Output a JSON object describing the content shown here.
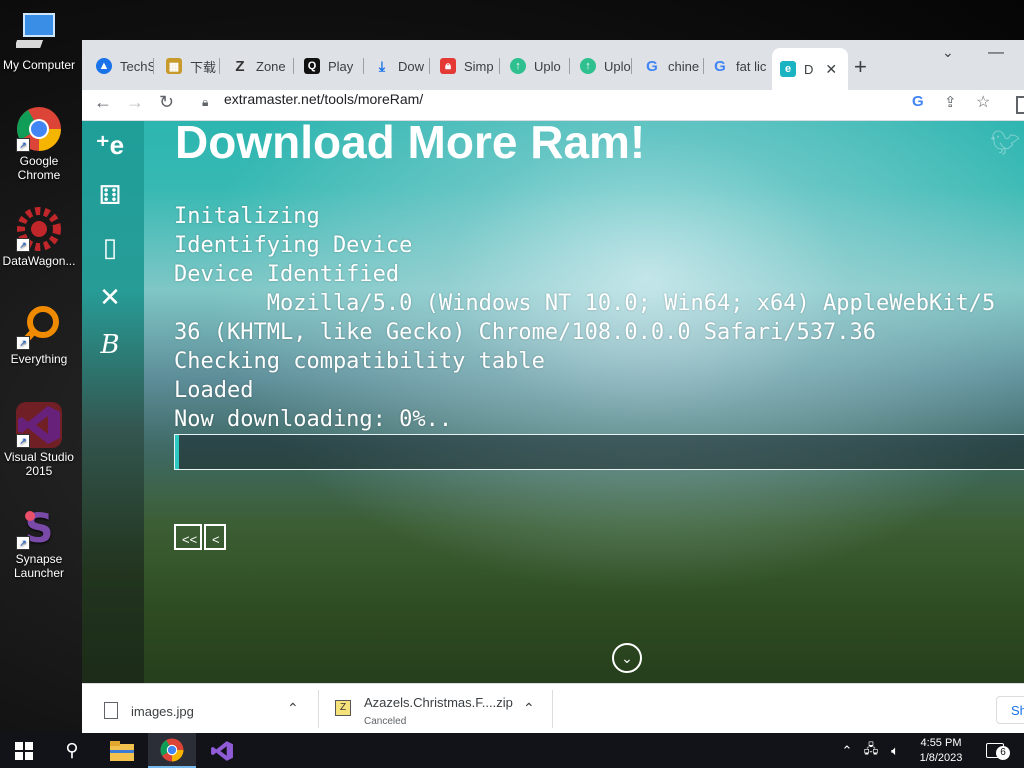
{
  "desktop": {
    "icons": [
      {
        "label": "My Computer"
      },
      {
        "label": "Google Chrome"
      },
      {
        "label": "DataWagon..."
      },
      {
        "label": "Everything"
      },
      {
        "label": "Visual Studio 2015"
      },
      {
        "label": "Synapse Launcher"
      }
    ]
  },
  "browser": {
    "tabs": [
      {
        "label": "TechS",
        "icon": "tech-icon",
        "color": "#1a73e8"
      },
      {
        "label": "下载",
        "icon": "download-site-icon",
        "color": "#c79a2a"
      },
      {
        "label": "Zone",
        "icon": "zone-icon",
        "color": "#333333"
      },
      {
        "label": "Play",
        "icon": "play-icon",
        "color": "#111111"
      },
      {
        "label": "Dow",
        "icon": "download-icon",
        "color": "#1a73e8"
      },
      {
        "label": "Simp",
        "icon": "lock-icon",
        "color": "#e53935"
      },
      {
        "label": "Uplo",
        "icon": "upload-icon",
        "color": "#2ec08e"
      },
      {
        "label": "Uplo",
        "icon": "upload-icon",
        "color": "#2ec08e"
      },
      {
        "label": "chine",
        "icon": "google-icon",
        "color": "#4285f4"
      },
      {
        "label": "fat lic",
        "icon": "google-icon",
        "color": "#4285f4"
      },
      {
        "label": "D",
        "icon": "extramaster-icon",
        "color": "#19b3c2"
      }
    ],
    "url": "extramaster.net/tools/moreRam/",
    "page": {
      "title": "Download More Ram!",
      "lines": [
        "Initalizing",
        "Identifying Device",
        "Device Identified",
        "       Mozilla/5.0 (Windows NT 10.0; Win64; x64) AppleWebKit/5",
        "36 (KHTML, like Gecko) Chrome/108.0.0.0 Safari/537.36",
        "Checking compatibility table",
        "Loaded",
        "Now downloading: 0%.."
      ],
      "progress_percent": 0,
      "btn_first": "<<",
      "btn_prev": "<"
    },
    "downloads": [
      {
        "name": "images.jpg",
        "status": ""
      },
      {
        "name": "Azazels.Christmas.F....zip",
        "status": "Canceled"
      }
    ],
    "show_all": "Sh"
  },
  "taskbar": {
    "time": "4:55 PM",
    "date": "1/8/2023",
    "notifications": "6"
  }
}
